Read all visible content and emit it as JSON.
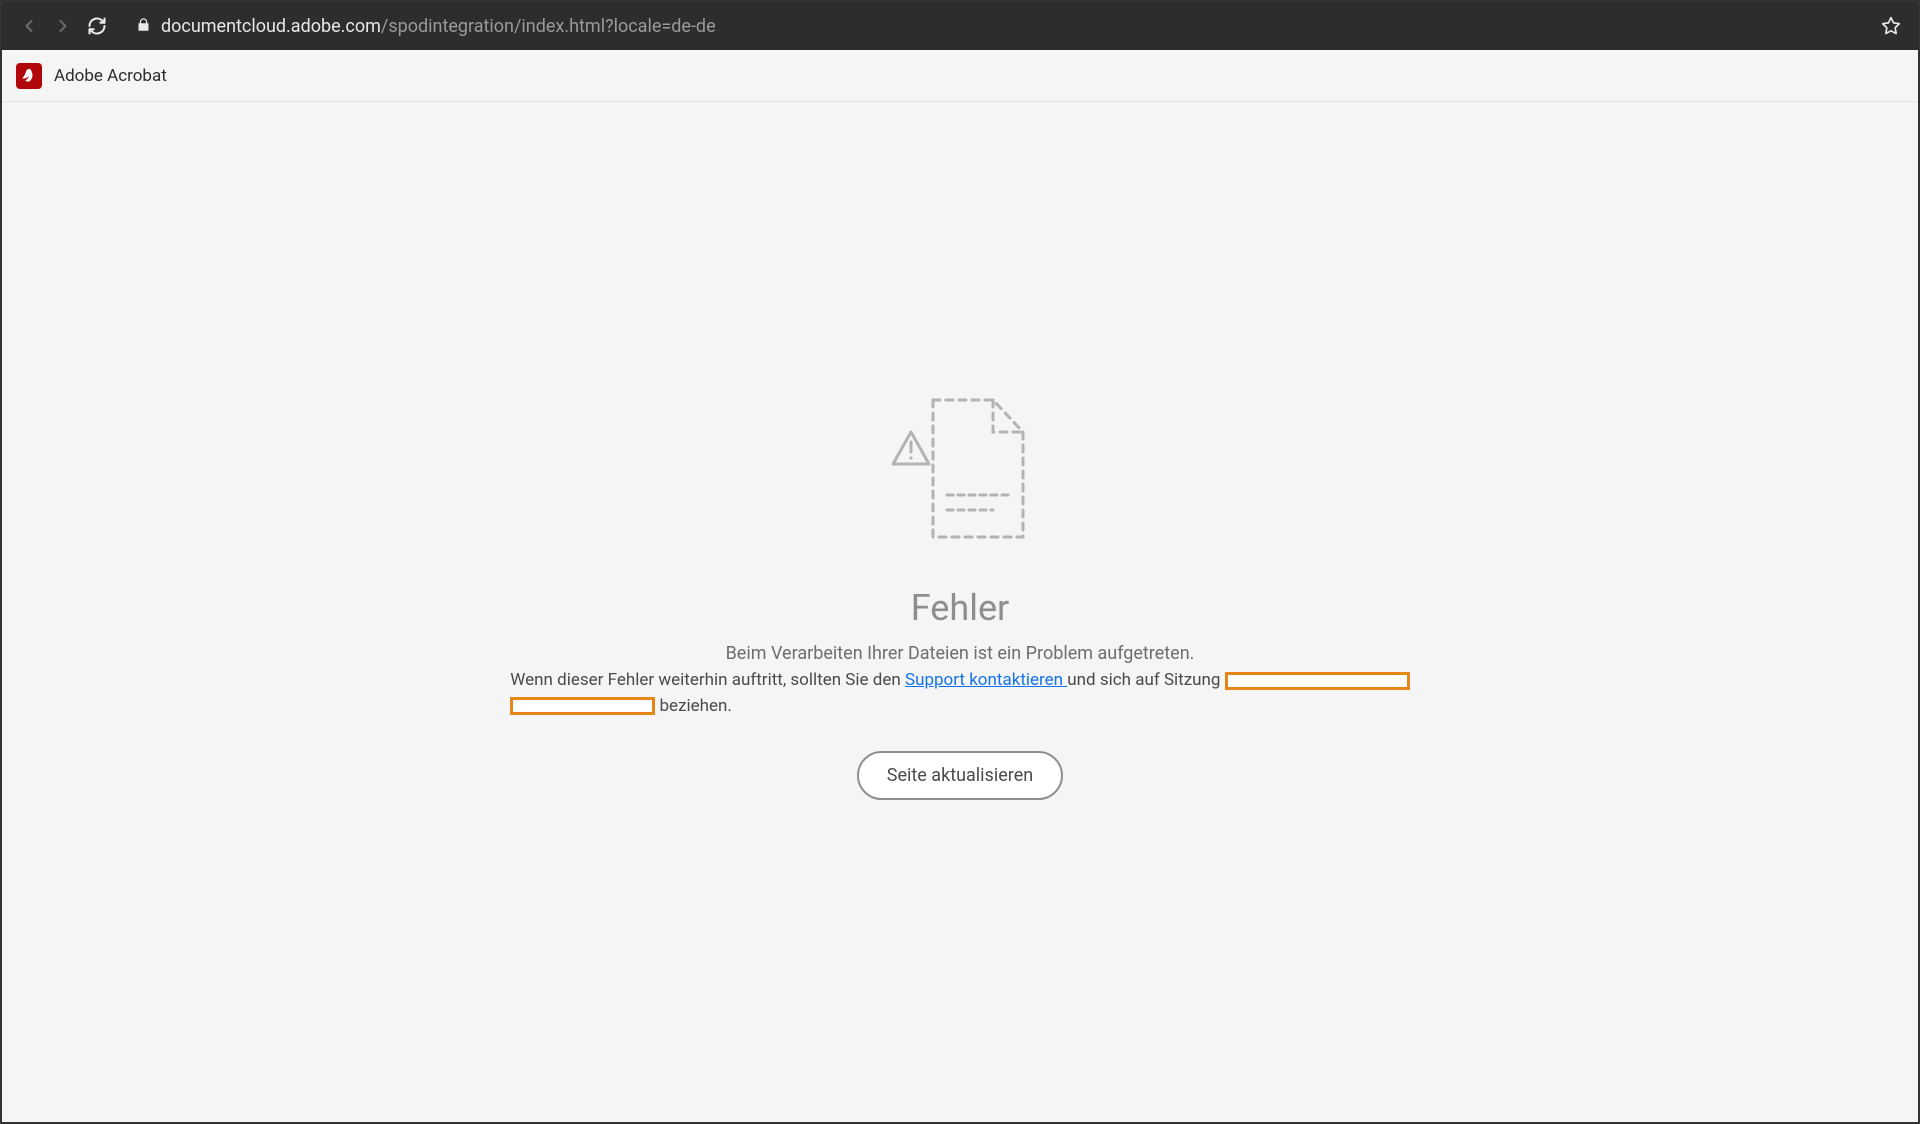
{
  "browser": {
    "url_domain": "documentcloud.adobe.com",
    "url_path": "/spodintegration/index.html?locale=de-de"
  },
  "app": {
    "title": "Adobe Acrobat"
  },
  "error": {
    "heading": "Fehler",
    "subtext": "Beim Verarbeiten Ihrer Dateien ist ein Problem aufgetreten.",
    "detail_prefix": "Wenn dieser Fehler weiterhin auftritt, sollten Sie den ",
    "support_link_label": "Support kontaktieren ",
    "detail_mid": "und sich auf Sitzung",
    "detail_suffix": " beziehen.",
    "refresh_button_label": "Seite aktualisieren"
  }
}
